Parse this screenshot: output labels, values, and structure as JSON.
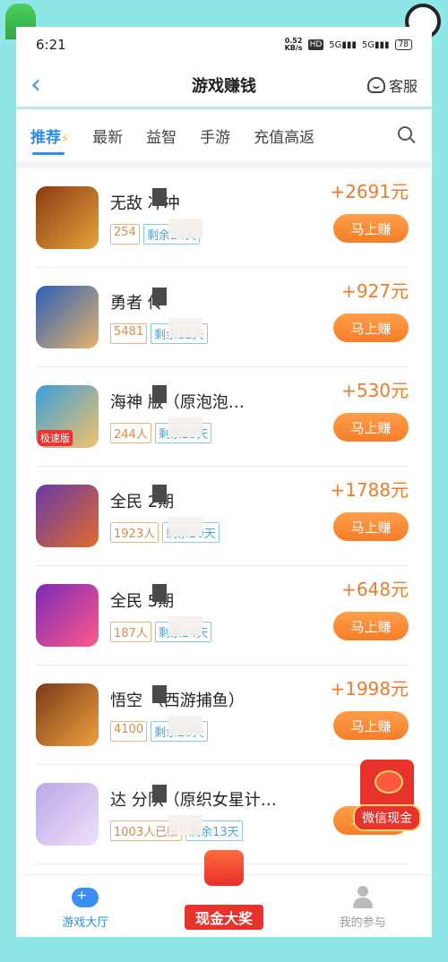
{
  "status_bar": {
    "time": "6:21",
    "net_speed_value": "0.52",
    "net_speed_unit": "KB/s",
    "hd": "HD",
    "signal1": "5G",
    "signal2": "5G",
    "battery": "78"
  },
  "nav": {
    "title": "游戏赚钱",
    "service_label": "客服"
  },
  "tabs": [
    {
      "label": "推荐",
      "active": true
    },
    {
      "label": "最新"
    },
    {
      "label": "益智"
    },
    {
      "label": "手游"
    },
    {
      "label": "充值高返"
    }
  ],
  "games": [
    {
      "name": "无敌 冲冲",
      "count": "254",
      "days": "剩余24天",
      "reward": "+2691元",
      "button": "马上赚",
      "icon_colors": [
        "#8b3a12",
        "#e6a33a"
      ]
    },
    {
      "name": "勇者 传",
      "count": "5481",
      "days": "剩余12天",
      "reward": "+927元",
      "button": "马上赚",
      "icon_colors": [
        "#2c5fb8",
        "#e6b36a"
      ]
    },
    {
      "name": "海神 版（原泡泡…",
      "count": "244人",
      "days": "剩余25天",
      "reward": "+530元",
      "button": "马上赚",
      "icon_colors": [
        "#3aa0d8",
        "#f5c16a"
      ],
      "icon_badge": "极速版"
    },
    {
      "name": "全民 2期",
      "count": "1923人",
      "days": "剩余20天",
      "reward": "+1788元",
      "button": "马上赚",
      "icon_colors": [
        "#6a3aa8",
        "#e06a2a"
      ]
    },
    {
      "name": "全民 5期",
      "count": "187人",
      "days": "剩余24天",
      "reward": "+648元",
      "button": "马上赚",
      "icon_colors": [
        "#7a2ab8",
        "#ff5a8a"
      ]
    },
    {
      "name": "悟空 （西游捕鱼）",
      "count": "4100",
      "days": "剩余20天",
      "reward": "+1998元",
      "button": "马上赚",
      "icon_colors": [
        "#7a3a18",
        "#f0a040"
      ]
    },
    {
      "name": "达 分队（原织女星计…",
      "count": "1003人已赚",
      "days": "剩余13天",
      "reward": "+1",
      "button": "马上赚",
      "icon_colors": [
        "#b8a8e8",
        "#f0e0f8"
      ]
    }
  ],
  "floating_promo": {
    "label": "微信现金"
  },
  "bottom_nav": [
    {
      "label": "游戏大厅",
      "active": true
    },
    {
      "label": "现金大奖"
    },
    {
      "label": "我的参与"
    }
  ],
  "colors": {
    "accent_blue": "#2d8cf0",
    "reward_orange": "#f07b2e",
    "page_bg": "#8ee6e6"
  }
}
